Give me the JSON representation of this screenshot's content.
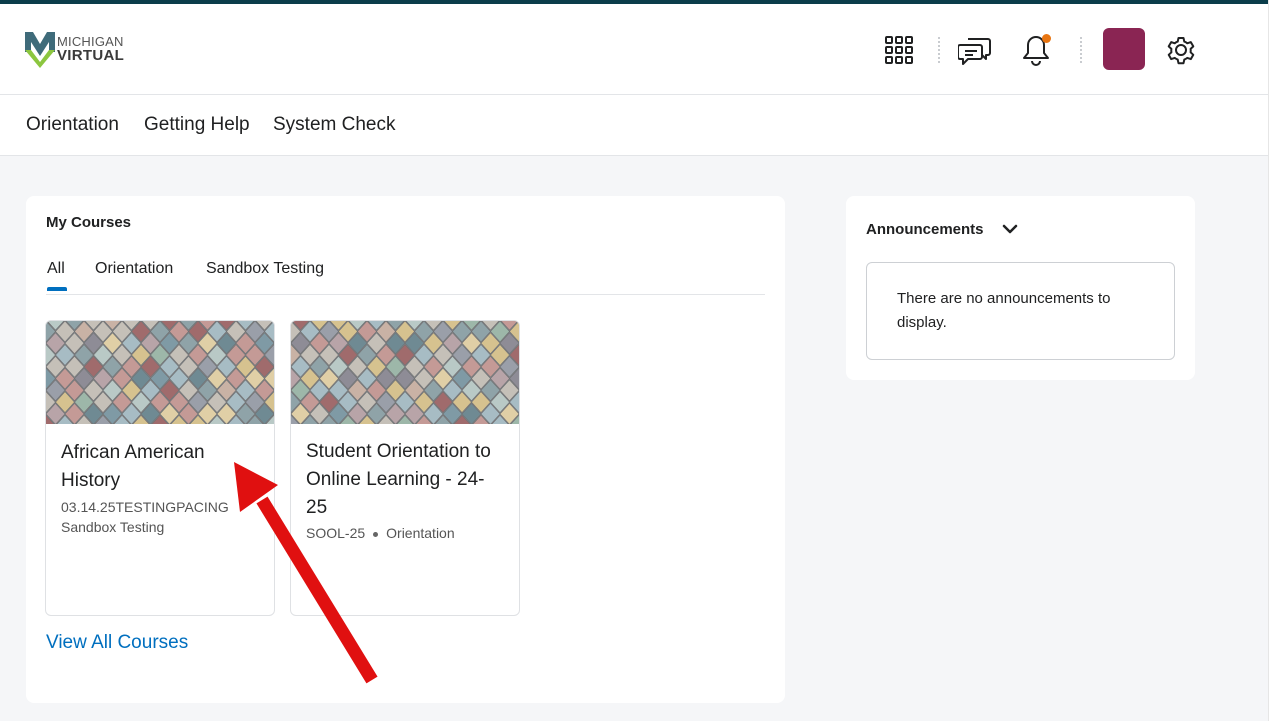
{
  "brand": {
    "line1": "MICHIGAN",
    "line2": "VIRTUAL"
  },
  "header": {
    "icons": [
      "app-grid-icon",
      "message-icon",
      "bell-icon",
      "gear-icon"
    ],
    "notification_dot_color": "#e87511",
    "avatar_color": "#8a2553"
  },
  "nav": {
    "items": [
      {
        "label": "Orientation"
      },
      {
        "label": "Getting Help"
      },
      {
        "label": "System Check"
      }
    ]
  },
  "courses_widget": {
    "title": "My Courses",
    "tabs": [
      {
        "label": "All",
        "selected": true
      },
      {
        "label": "Orientation",
        "selected": false
      },
      {
        "label": "Sandbox Testing",
        "selected": false
      }
    ],
    "courses": [
      {
        "title_line1": "African American",
        "title_line2": "History",
        "code": "03.14.25TESTINGPACING",
        "semester": "Sandbox Testing"
      },
      {
        "title_line1": "Student Orientation to",
        "title_line2": "Online Learning - 24-",
        "title_line3": "25",
        "code": "SOOL-25",
        "semester": "Orientation"
      }
    ],
    "view_all_label": "View All Courses"
  },
  "announcements": {
    "title": "Announcements",
    "empty_message": "There are no announcements to display."
  },
  "colors": {
    "accent_link": "#006fbf",
    "top_accent": "#0b3d4a",
    "annotation_arrow": "#e01010"
  }
}
